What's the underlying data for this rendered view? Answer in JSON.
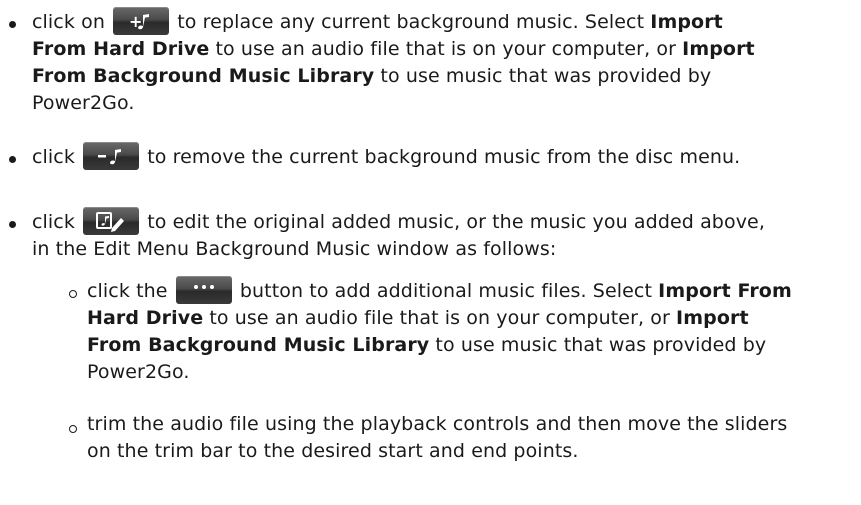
{
  "items": [
    {
      "pre": "click on ",
      "icon": "add-music-icon",
      "l1_rest": " to replace any current background music. Select ",
      "l1_bold": "Import",
      "l2_bold1": "From Hard Drive",
      "l2_mid": " to use an audio file that is on your computer, or ",
      "l2_bold2": "Import",
      "l3_bold": "From Background Music Library",
      "l3_rest": " to use music that was provided by",
      "l4": "Power2Go."
    },
    {
      "pre": "click ",
      "icon": "remove-music-icon",
      "rest": " to remove the current background music from the disc menu."
    },
    {
      "pre": "click ",
      "icon": "edit-music-icon",
      "l1_rest": " to edit the original added music, or the music you added above,",
      "l2": "in the Edit Menu Background Music window as follows:"
    }
  ],
  "subitems": [
    {
      "pre": "click the ",
      "icon": "more-options-icon",
      "l1_rest": " button to add additional music files. Select ",
      "l1_bold": "Import From",
      "l2_bold1": "Hard Drive",
      "l2_mid": " to use an audio file that is on your computer, or ",
      "l2_bold2": "Import",
      "l3_bold": "From Background Music Library",
      "l3_rest": " to use music that was provided by",
      "l4": "Power2Go."
    },
    {
      "l1": "trim the audio file using the playback controls and then move the sliders",
      "l2": "on the trim bar to the desired start and end points."
    }
  ]
}
